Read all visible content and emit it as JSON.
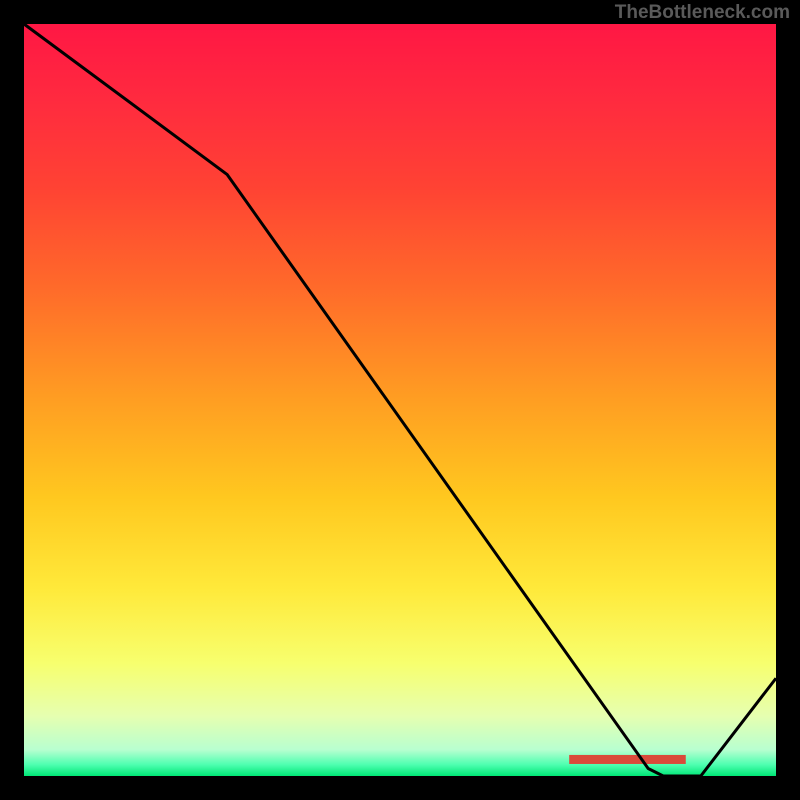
{
  "attribution": "TheBottleneck.com",
  "chart_data": {
    "type": "line",
    "title": "",
    "xlabel": "",
    "ylabel": "",
    "xlim": [
      0,
      100
    ],
    "ylim": [
      0,
      100
    ],
    "line_points": [
      {
        "x": 0,
        "y": 100
      },
      {
        "x": 27,
        "y": 80
      },
      {
        "x": 83,
        "y": 1
      },
      {
        "x": 85,
        "y": 0
      },
      {
        "x": 90,
        "y": 0
      },
      {
        "x": 100,
        "y": 13
      }
    ],
    "gradient_stops": [
      {
        "offset": 0.0,
        "color": "#ff1744"
      },
      {
        "offset": 0.1,
        "color": "#ff2a3f"
      },
      {
        "offset": 0.22,
        "color": "#ff4333"
      },
      {
        "offset": 0.35,
        "color": "#ff6a2a"
      },
      {
        "offset": 0.5,
        "color": "#ff9e22"
      },
      {
        "offset": 0.63,
        "color": "#ffc81f"
      },
      {
        "offset": 0.75,
        "color": "#ffe93a"
      },
      {
        "offset": 0.85,
        "color": "#f7ff6e"
      },
      {
        "offset": 0.92,
        "color": "#e6ffb0"
      },
      {
        "offset": 0.965,
        "color": "#b8ffd0"
      },
      {
        "offset": 0.985,
        "color": "#4dffb0"
      },
      {
        "offset": 1.0,
        "color": "#00e676"
      }
    ],
    "anomaly_band": {
      "x0": 0.725,
      "x1": 0.88,
      "y": 0.972,
      "height": 0.012,
      "color": "#d94a3a"
    }
  }
}
